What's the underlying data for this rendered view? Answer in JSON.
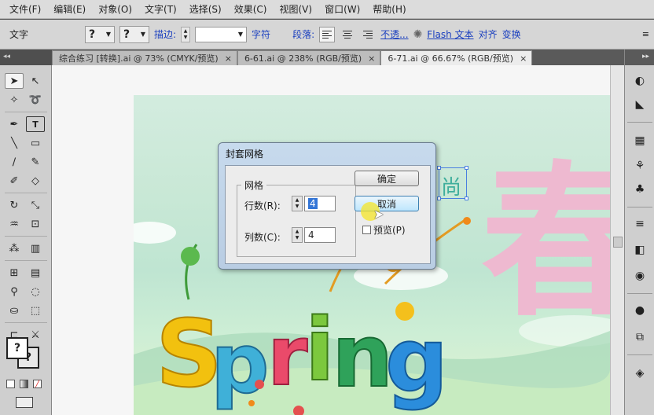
{
  "menu": [
    "文件(F)",
    "编辑(E)",
    "对象(O)",
    "文字(T)",
    "选择(S)",
    "效果(C)",
    "视图(V)",
    "窗口(W)",
    "帮助(H)"
  ],
  "control": {
    "tool_label": "文字",
    "char_q1": "?",
    "char_q2": "?",
    "stroke_label": "描边:",
    "char_link": "字符",
    "para_link": "段落:",
    "opacity_link": "不透...",
    "flash_link": "Flash 文本",
    "align_link": "对齐",
    "transform_link": "变换"
  },
  "tabs": [
    {
      "label": "综合练习 [转换].ai @ 73% (CMYK/预览)",
      "active": false
    },
    {
      "label": "6-61.ai @ 238% (RGB/预览)",
      "active": false
    },
    {
      "label": "6-71.ai @ 66.67% (RGB/预览)",
      "active": true
    }
  ],
  "tab_close": "×",
  "collapse_glyph": "◂◂",
  "expand_glyph": "▸▸",
  "artwork": {
    "chinese_char": "春",
    "selected_text": "尚",
    "spring_word": "Spring"
  },
  "dialog": {
    "title": "封套网格",
    "group_label": "网格",
    "rows_label": "行数(R):",
    "rows_value": "4",
    "cols_label": "列数(C):",
    "cols_value": "4",
    "ok_label": "确定",
    "cancel_label": "取消",
    "preview_label": "预览(P)",
    "preview_checked": false
  },
  "colors": {
    "accent_link": "#1a3fbf",
    "chinese_pink": "#eeb9d0",
    "selection_blue": "#3375d6"
  },
  "right_panel_icons": [
    "color-icon",
    "gradient-icon",
    "swatches-icon",
    "brushes-icon",
    "symbols-icon",
    "stroke-icon",
    "transparency-icon",
    "appearance-icon",
    "graphic-styles-icon",
    "layers-icon",
    "artboards-icon"
  ]
}
